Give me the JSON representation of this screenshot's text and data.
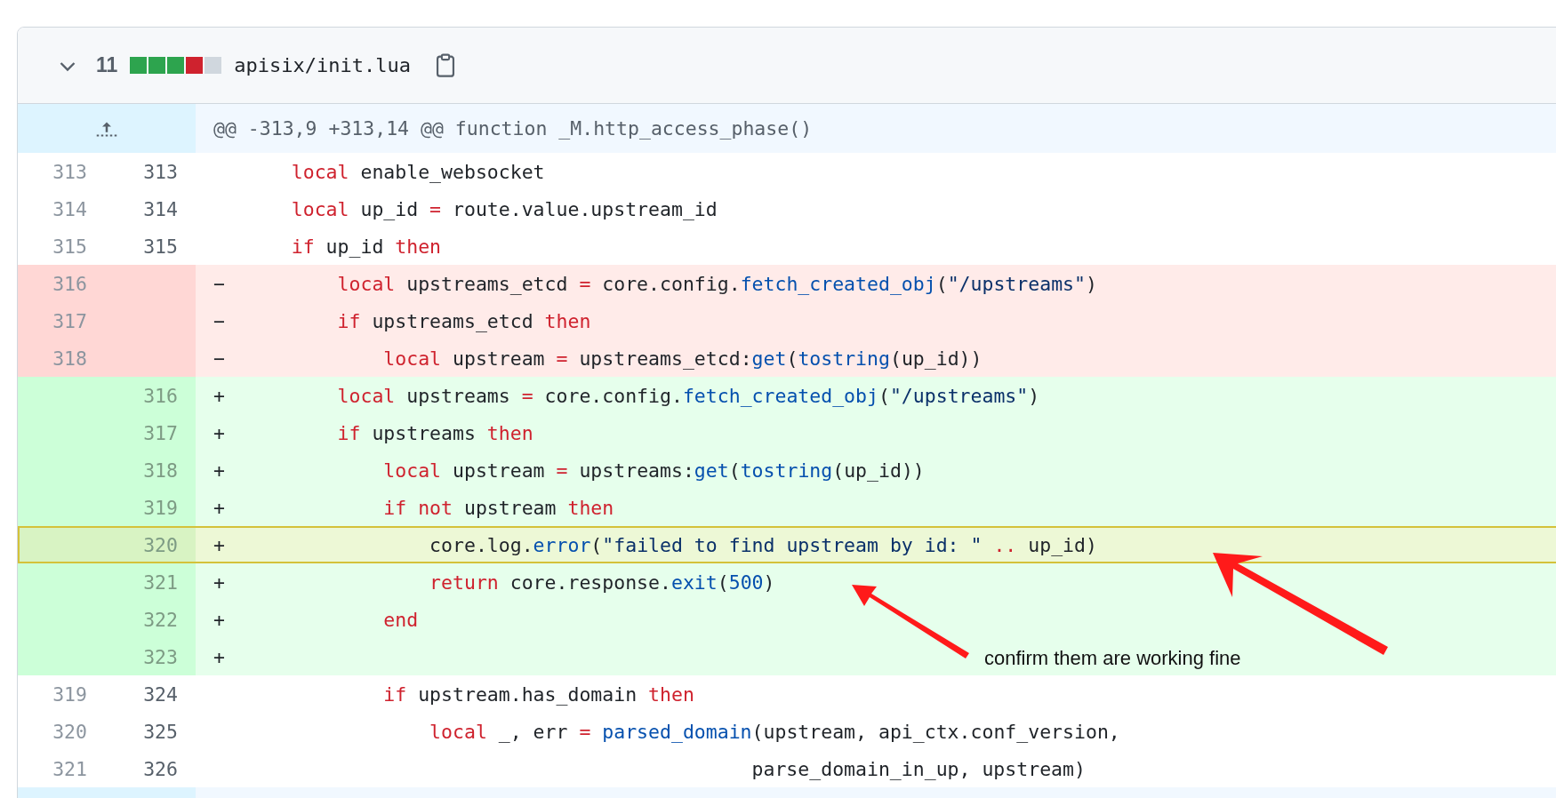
{
  "file": {
    "expanded": true,
    "changes": "11",
    "stat": [
      {
        "kind": "add"
      },
      {
        "kind": "add"
      },
      {
        "kind": "add"
      },
      {
        "kind": "del"
      },
      {
        "kind": "neutral"
      }
    ],
    "path": "apisix/init.lua"
  },
  "hunk": {
    "header": "@@ -313,9 +313,14 @@ function _M.http_access_phase()"
  },
  "lines": [
    {
      "kind": "context",
      "old": "313",
      "new": "313",
      "selected": false,
      "code": [
        {
          "kind": "keyword",
          "t": "    local"
        },
        {
          "kind": "plain",
          "t": " enable_websocket"
        }
      ]
    },
    {
      "kind": "context",
      "old": "314",
      "new": "314",
      "selected": false,
      "code": [
        {
          "kind": "keyword",
          "t": "    local"
        },
        {
          "kind": "plain",
          "t": " up_id "
        },
        {
          "kind": "keyword",
          "t": "="
        },
        {
          "kind": "plain",
          "t": " route.value.upstream_id"
        }
      ]
    },
    {
      "kind": "context",
      "old": "315",
      "new": "315",
      "selected": false,
      "code": [
        {
          "kind": "keyword",
          "t": "    if"
        },
        {
          "kind": "plain",
          "t": " up_id "
        },
        {
          "kind": "keyword",
          "t": "then"
        }
      ]
    },
    {
      "kind": "del",
      "old": "316",
      "marker": "−",
      "selected": false,
      "code": [
        {
          "kind": "keyword",
          "t": "        local"
        },
        {
          "kind": "plain",
          "t": " upstreams_etcd "
        },
        {
          "kind": "keyword",
          "t": "="
        },
        {
          "kind": "plain",
          "t": " core.config."
        },
        {
          "kind": "function",
          "t": "fetch_created_obj"
        },
        {
          "kind": "plain",
          "t": "("
        },
        {
          "kind": "string",
          "t": "\"/upstreams\""
        },
        {
          "kind": "plain",
          "t": ")"
        }
      ]
    },
    {
      "kind": "del",
      "old": "317",
      "marker": "−",
      "selected": false,
      "code": [
        {
          "kind": "keyword",
          "t": "        if"
        },
        {
          "kind": "plain",
          "t": " upstreams_etcd "
        },
        {
          "kind": "keyword",
          "t": "then"
        }
      ]
    },
    {
      "kind": "del",
      "old": "318",
      "marker": "−",
      "selected": false,
      "code": [
        {
          "kind": "keyword",
          "t": "            local"
        },
        {
          "kind": "plain",
          "t": " upstream "
        },
        {
          "kind": "keyword",
          "t": "="
        },
        {
          "kind": "plain",
          "t": " upstreams_etcd:"
        },
        {
          "kind": "function",
          "t": "get"
        },
        {
          "kind": "plain",
          "t": "("
        },
        {
          "kind": "function",
          "t": "tostring"
        },
        {
          "kind": "plain",
          "t": "(up_id))"
        }
      ]
    },
    {
      "kind": "add",
      "new": "316",
      "marker": "+",
      "selected": false,
      "code": [
        {
          "kind": "keyword",
          "t": "        local"
        },
        {
          "kind": "plain",
          "t": " upstreams "
        },
        {
          "kind": "keyword",
          "t": "="
        },
        {
          "kind": "plain",
          "t": " core.config."
        },
        {
          "kind": "function",
          "t": "fetch_created_obj"
        },
        {
          "kind": "plain",
          "t": "("
        },
        {
          "kind": "string",
          "t": "\"/upstreams\""
        },
        {
          "kind": "plain",
          "t": ")"
        }
      ]
    },
    {
      "kind": "add",
      "new": "317",
      "marker": "+",
      "selected": false,
      "code": [
        {
          "kind": "keyword",
          "t": "        if"
        },
        {
          "kind": "plain",
          "t": " upstreams "
        },
        {
          "kind": "keyword",
          "t": "then"
        }
      ]
    },
    {
      "kind": "add",
      "new": "318",
      "marker": "+",
      "selected": false,
      "code": [
        {
          "kind": "keyword",
          "t": "            local"
        },
        {
          "kind": "plain",
          "t": " upstream "
        },
        {
          "kind": "keyword",
          "t": "="
        },
        {
          "kind": "plain",
          "t": " upstreams:"
        },
        {
          "kind": "function",
          "t": "get"
        },
        {
          "kind": "plain",
          "t": "("
        },
        {
          "kind": "function",
          "t": "tostring"
        },
        {
          "kind": "plain",
          "t": "(up_id))"
        }
      ]
    },
    {
      "kind": "add",
      "new": "319",
      "marker": "+",
      "selected": false,
      "code": [
        {
          "kind": "keyword",
          "t": "            if"
        },
        {
          "kind": "keyword",
          "t": " not"
        },
        {
          "kind": "plain",
          "t": " upstream "
        },
        {
          "kind": "keyword",
          "t": "then"
        }
      ]
    },
    {
      "kind": "add",
      "new": "320",
      "marker": "+",
      "selected": true,
      "code": [
        {
          "kind": "plain",
          "t": "                core.log."
        },
        {
          "kind": "function",
          "t": "error"
        },
        {
          "kind": "plain",
          "t": "("
        },
        {
          "kind": "string",
          "t": "\"failed to find upstream by id: \""
        },
        {
          "kind": "keyword",
          "t": " .."
        },
        {
          "kind": "plain",
          "t": " up_id)"
        }
      ]
    },
    {
      "kind": "add",
      "new": "321",
      "marker": "+",
      "selected": false,
      "code": [
        {
          "kind": "keyword",
          "t": "                return"
        },
        {
          "kind": "plain",
          "t": " core.response."
        },
        {
          "kind": "function",
          "t": "exit"
        },
        {
          "kind": "plain",
          "t": "("
        },
        {
          "kind": "function",
          "t": "500"
        },
        {
          "kind": "plain",
          "t": ")"
        }
      ]
    },
    {
      "kind": "add",
      "new": "322",
      "marker": "+",
      "selected": false,
      "code": [
        {
          "kind": "keyword",
          "t": "            end"
        }
      ]
    },
    {
      "kind": "add",
      "new": "323",
      "marker": "+",
      "selected": false
    },
    {
      "kind": "context",
      "old": "319",
      "new": "324",
      "selected": false,
      "code": [
        {
          "kind": "keyword",
          "t": "            if"
        },
        {
          "kind": "plain",
          "t": " upstream.has_domain "
        },
        {
          "kind": "keyword",
          "t": "then"
        }
      ]
    },
    {
      "kind": "context",
      "old": "320",
      "new": "325",
      "selected": false,
      "code": [
        {
          "kind": "keyword",
          "t": "                local"
        },
        {
          "kind": "plain",
          "t": " _, err "
        },
        {
          "kind": "keyword",
          "t": "="
        },
        {
          "kind": "function",
          "t": " parsed_domain"
        },
        {
          "kind": "plain",
          "t": "(upstream, api_ctx.conf_version,"
        }
      ]
    },
    {
      "kind": "context",
      "old": "321",
      "new": "326",
      "selected": false,
      "code": [
        {
          "kind": "plain",
          "t": "                                            parse_domain_in_up, upstream)"
        }
      ]
    }
  ],
  "annotation": {
    "text": "confirm them are working fine"
  }
}
